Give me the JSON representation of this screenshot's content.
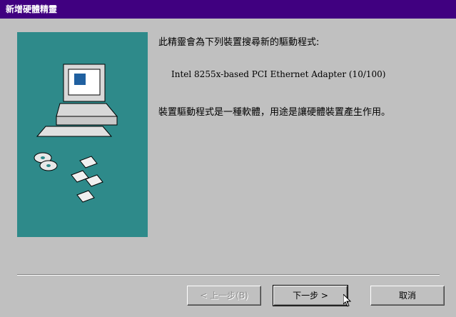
{
  "window": {
    "title": "新增硬體精靈"
  },
  "main": {
    "intro": "此精靈會為下列裝置搜尋新的驅動程式:",
    "device": "Intel 8255x-based PCI Ethernet Adapter (10/100)",
    "description": "裝置驅動程式是一種軟體，用途是讓硬體裝置產生作用。"
  },
  "buttons": {
    "back": "< 上一步(B)",
    "next": "下一步 >",
    "cancel": "取消"
  },
  "colors": {
    "titlebar": "#400080",
    "panel": "#2e8a8a",
    "dialog": "#c0c0c0"
  }
}
